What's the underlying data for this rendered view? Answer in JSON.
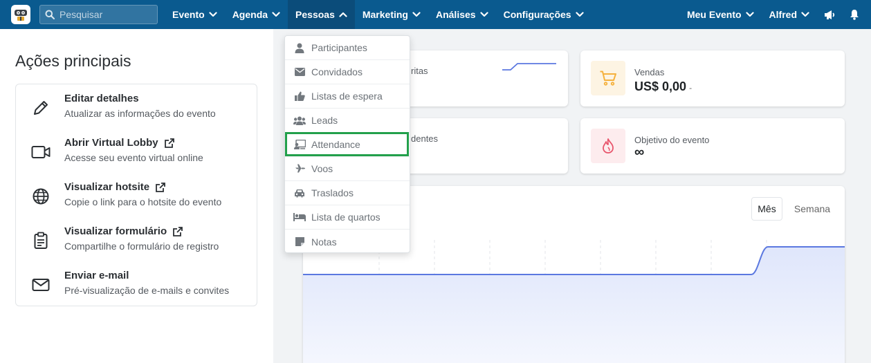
{
  "navbar": {
    "search_placeholder": "Pesquisar",
    "menus": [
      {
        "label": "Evento"
      },
      {
        "label": "Agenda"
      },
      {
        "label": "Pessoas"
      },
      {
        "label": "Marketing"
      },
      {
        "label": "Análises"
      },
      {
        "label": "Configurações"
      }
    ],
    "right_menus": [
      {
        "label": "Meu Evento"
      },
      {
        "label": "Alfred"
      }
    ],
    "active_menu": "Pessoas",
    "colors": {
      "bar": "#0a5a8f",
      "active": "#0b4c7a"
    },
    "icons": [
      "search-icon",
      "megaphone-icon",
      "bell-icon"
    ]
  },
  "left_panel": {
    "title": "Ações principais",
    "actions": [
      {
        "icon": "pencil-icon",
        "title": "Editar detalhes",
        "subtitle": "Atualizar as informações do evento",
        "external": false
      },
      {
        "icon": "video-camera-icon",
        "title": "Abrir Virtual Lobby",
        "subtitle": "Acesse seu evento virtual online",
        "external": true
      },
      {
        "icon": "globe-icon",
        "title": "Visualizar hotsite",
        "subtitle": "Copie o link para o hotsite do evento",
        "external": true
      },
      {
        "icon": "clipboard-icon",
        "title": "Visualizar formulário",
        "subtitle": "Compartilhe o formulário de registro",
        "external": true
      },
      {
        "icon": "envelope-icon",
        "title": "Enviar e-mail",
        "subtitle": "Pré-visualização de e-mails e convites",
        "external": false
      }
    ]
  },
  "stats": {
    "registrations_partial_label": "ritas",
    "attendees_partial_label": "dentes",
    "sales": {
      "label": "Vendas",
      "value": "US$ 0,00",
      "delta": "-",
      "icon": "cart-icon",
      "color": "#f5b13d"
    },
    "goal": {
      "label": "Objetivo do evento",
      "value": "∞",
      "icon": "flame-icon",
      "color": "#e8546b"
    }
  },
  "chart": {
    "toggles": [
      {
        "label": "Mês",
        "active": true
      },
      {
        "label": "Semana",
        "active": false
      }
    ],
    "line_color": "#5b78e0"
  },
  "dropdown": {
    "items": [
      {
        "icon": "user-icon",
        "label": "Participantes"
      },
      {
        "icon": "envelope-icon",
        "label": "Convidados"
      },
      {
        "icon": "thumbs-up-icon",
        "label": "Listas de espera"
      },
      {
        "icon": "users-icon",
        "label": "Leads"
      },
      {
        "icon": "attendance-icon",
        "label": "Attendance"
      },
      {
        "icon": "plane-icon",
        "label": "Voos"
      },
      {
        "icon": "car-icon",
        "label": "Traslados"
      },
      {
        "icon": "bed-icon",
        "label": "Lista de quartos"
      },
      {
        "icon": "note-icon",
        "label": "Notas"
      }
    ],
    "highlighted_item": "Attendance",
    "highlight_color": "#22a04b"
  }
}
